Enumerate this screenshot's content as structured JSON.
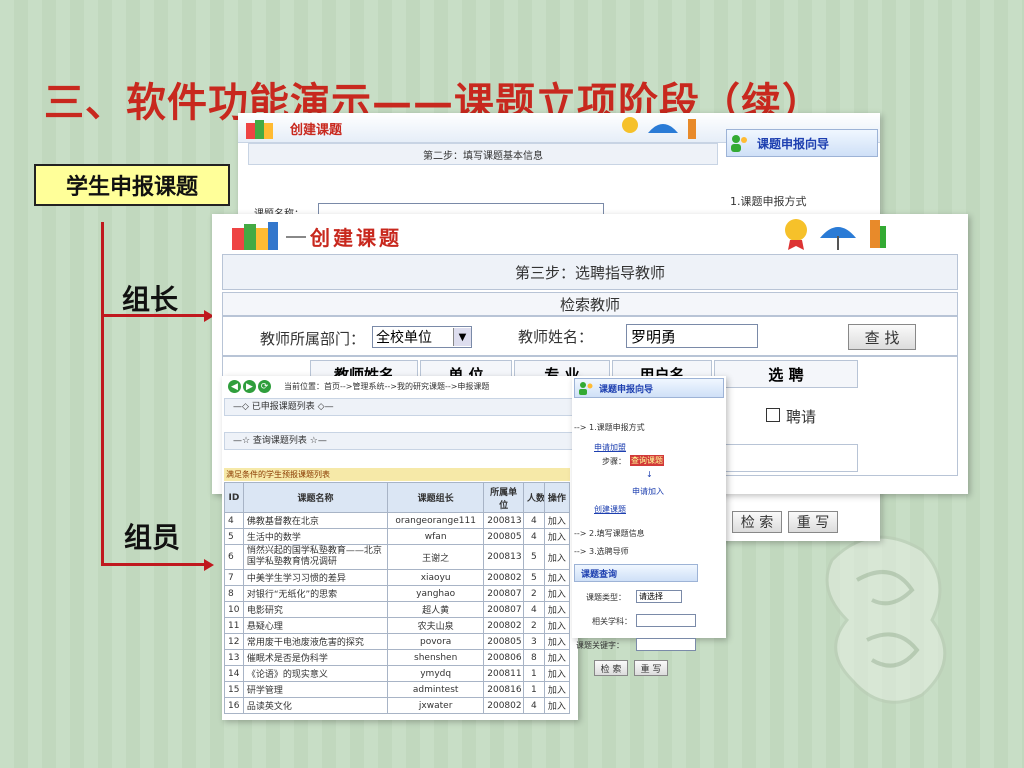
{
  "slide": {
    "title": "三、软件功能演示——课题立项阶段（续）",
    "role_box": "学生申报课题",
    "leader_label": "组长",
    "member_label": "组员"
  },
  "back_window": {
    "header": "创建课题",
    "step_title": "第二步：填写课题基本信息",
    "field_label": "课题名称：",
    "sidebar_header": "课题申报向导",
    "sidebar_item": "1.课题申报方式",
    "search_button": "检 索",
    "reset_button": "重 写"
  },
  "front_window": {
    "header": "创建课题",
    "step_title": "第三步：选聘指导教师",
    "search_title": "检索教师",
    "dept_label": "教师所属部门：",
    "dept_value": "全校单位",
    "name_label": "教师姓名：",
    "name_value": "罗明勇",
    "find_button": "查  找",
    "columns": [
      "教师姓名",
      "单 位",
      "专 业",
      "用户名",
      "选 聘"
    ],
    "row_username_partial": "g",
    "hire_label": "聘请"
  },
  "list_window": {
    "breadcrumb": "当前位置：首页-->管理系统-->我的研究课题-->申报课题",
    "applied_list": "—◇ 已申报课题列表 ◇—",
    "query_list": "—☆ 查询课题列表 ☆—",
    "result_header": "满足条件的学生预报课题列表",
    "columns": [
      "ID",
      "课题名称",
      "课题组长",
      "所属单位",
      "人数",
      "操作"
    ],
    "rows": [
      [
        "4",
        "佛教基督教在北京",
        "orangeorange111",
        "200813",
        "4",
        "加入"
      ],
      [
        "5",
        "生活中的数学",
        "wfan",
        "200805",
        "4",
        "加入"
      ],
      [
        "6",
        "悄然兴起的国学私塾教育——北京国学私塾教育情况调研",
        "王谢之",
        "200813",
        "5",
        "加入"
      ],
      [
        "7",
        "中美学生学习习惯的差异",
        "xiaoyu",
        "200802",
        "5",
        "加入"
      ],
      [
        "8",
        "对银行“无纸化”的思索",
        "yanghao",
        "200807",
        "2",
        "加入"
      ],
      [
        "10",
        "电影研究",
        "超人黄",
        "200807",
        "4",
        "加入"
      ],
      [
        "11",
        "悬疑心理",
        "农夫山泉",
        "200802",
        "2",
        "加入"
      ],
      [
        "12",
        "常用废干电池废液危害的探究",
        "povora",
        "200805",
        "3",
        "加入"
      ],
      [
        "13",
        "催眠术是否是伪科学",
        "shenshen",
        "200806",
        "8",
        "加入"
      ],
      [
        "14",
        "《论语》的现实意义",
        "ymydq",
        "200811",
        "1",
        "加入"
      ],
      [
        "15",
        "研学管理",
        "admintest",
        "200816",
        "1",
        "加入"
      ],
      [
        "16",
        "品读英文化",
        "jxwater",
        "200802",
        "4",
        "加入"
      ]
    ]
  },
  "wizard_window": {
    "header": "课题申报向导",
    "step1": "--> 1.课题申报方式",
    "apply_join": "申请加盟",
    "step_label": "步骤：",
    "query_topic": "查询课题",
    "apply_join_btn": "申请加入",
    "create_topic": "创建课题",
    "step2": "--> 2.填写课题信息",
    "step3": "--> 3.选聘导师",
    "query_header": "课题查询",
    "type_label": "课题类型：",
    "type_value": "请选择",
    "subject_label": "相关学科：",
    "keyword_label": "课题关键字：",
    "search_button": "检 索",
    "reset_button": "重 写"
  },
  "colors": {
    "title_red": "#c8281e",
    "role_yellow": "#ffff99",
    "line_red": "#c0181e",
    "bg_green": "#c5dcc2"
  }
}
